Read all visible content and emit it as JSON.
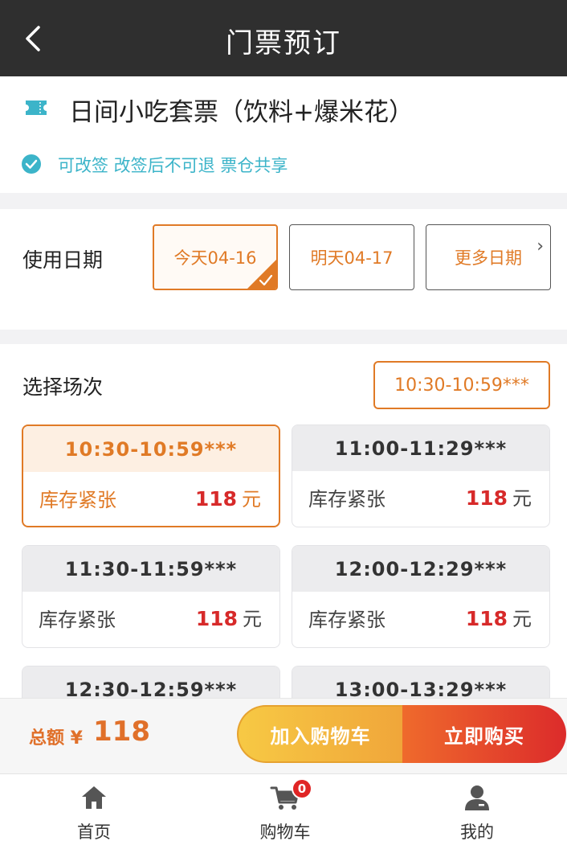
{
  "header": {
    "title": "门票预订"
  },
  "ticket": {
    "name": "日间小吃套票（饮料+爆米花）",
    "tags": "可改签 改签后不可退 票仓共享",
    "colors": {
      "tag": "#3cb4c9"
    }
  },
  "date_section": {
    "label": "使用日期",
    "options": [
      {
        "label": "今天04-16",
        "selected": true
      },
      {
        "label": "明天04-17",
        "selected": false
      },
      {
        "label": "更多日期",
        "selected": false
      }
    ]
  },
  "session_section": {
    "label": "选择场次",
    "selected_time": "10:30-10:59***",
    "slots": [
      {
        "time": "10:30-10:59***",
        "stock": "库存紧张",
        "price": "118",
        "unit": "元",
        "selected": true
      },
      {
        "time": "11:00-11:29***",
        "stock": "库存紧张",
        "price": "118",
        "unit": "元",
        "selected": false
      },
      {
        "time": "11:30-11:59***",
        "stock": "库存紧张",
        "price": "118",
        "unit": "元",
        "selected": false
      },
      {
        "time": "12:00-12:29***",
        "stock": "库存紧张",
        "price": "118",
        "unit": "元",
        "selected": false
      },
      {
        "time": "12:30-12:59***",
        "stock": "",
        "price": "",
        "unit": "",
        "selected": false
      },
      {
        "time": "13:00-13:29***",
        "stock": "",
        "price": "",
        "unit": "",
        "selected": false
      }
    ]
  },
  "footer": {
    "total_label": "总额 ¥",
    "total_amount": "118",
    "add_to_cart": "加入购物车",
    "buy_now": "立即购买"
  },
  "tabbar": {
    "items": [
      {
        "label": "首页",
        "icon": "home-icon"
      },
      {
        "label": "购物车",
        "icon": "cart-icon",
        "badge": "0"
      },
      {
        "label": "我的",
        "icon": "user-icon"
      }
    ]
  },
  "colors": {
    "accent": "#e07a26",
    "price": "#d72a2a",
    "header_bg": "#2f2f2f"
  }
}
